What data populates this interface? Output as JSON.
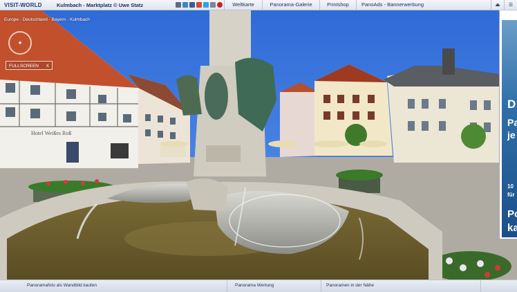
{
  "header": {
    "logo": "VISIT-WORLD",
    "title": "Kulmbach - Marktplatz © Uwe Statz",
    "nav": [
      {
        "label": "Weltkarte"
      },
      {
        "label": "Panorama-Galerie"
      },
      {
        "label": "Printshop"
      },
      {
        "label": "PanoAds - Bannerwerbung"
      }
    ]
  },
  "viewer": {
    "breadcrumb": "Europe · Deutschland · Bayern · Kulmbach",
    "fullscreen_label": "FULLSCREEN",
    "fullscreen_close": "X",
    "hotel_sign": "Hotel Weißes Roß"
  },
  "ad": {
    "line1": "D",
    "line2": "Pa",
    "line3": "je",
    "line4": "10",
    "line5": "für",
    "line6": "Po",
    "line7": "ka"
  },
  "footer": {
    "left": "Panoramafoto als Wandbild kaufen",
    "mid": "Panorama Wertung",
    "right": "Panoramen in der Nähe"
  }
}
